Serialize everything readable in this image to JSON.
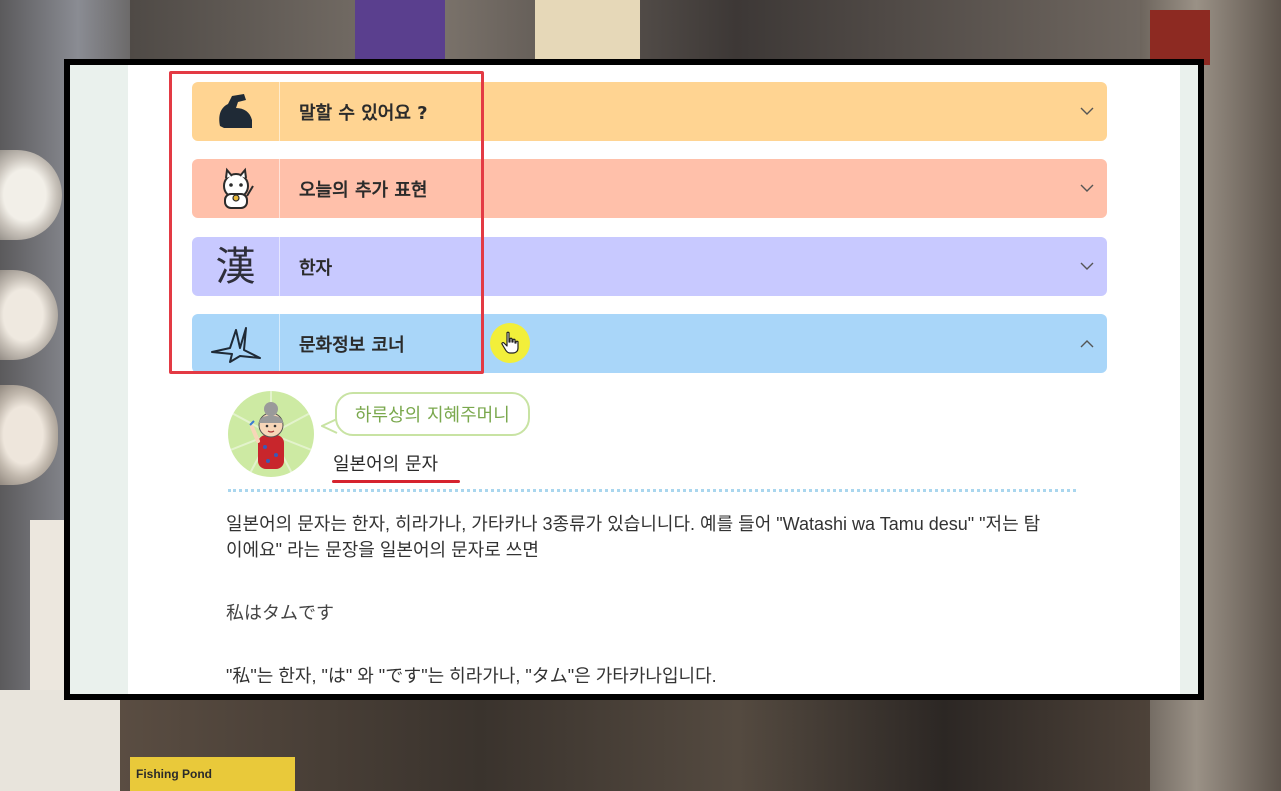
{
  "background": {
    "sign_text": "Fishing Pond"
  },
  "accordion": [
    {
      "label": "말할 수 있어요 ?",
      "icon": "flexed-arm-icon",
      "color": "#ffd492",
      "expanded": false
    },
    {
      "label": "오늘의 추가 표현",
      "icon": "lucky-cat-icon",
      "color": "#ffc0aa",
      "expanded": false
    },
    {
      "label": "한자",
      "icon": "kanji-icon",
      "glyph": "漢",
      "color": "#c8c9ff",
      "expanded": false
    },
    {
      "label": "문화정보 코너",
      "icon": "paper-crane-icon",
      "color": "#a9d6f9",
      "expanded": true
    }
  ],
  "culture": {
    "bubble": "하루상의 지혜주머니",
    "title": "일본어의 문자",
    "paragraphs": [
      "일본어의 문자는 한자, 히라가나, 가타카나 3종류가 있습니니다. 예를 들어 \"Watashi wa Tamu desu\" \"저는 탐이에요\" 라는 문장을 일본어의 문자로 쓰면",
      "私はタムです",
      "\"私\"는 한자, \"は\" 와 \"です\"는 히라가나, \"タム\"은 가타카나입니다."
    ]
  },
  "colors": {
    "highlight": "#e33a44",
    "cursor": "#f2ef3a",
    "underline": "#d6232e",
    "bubble_text": "#7aa84d"
  }
}
